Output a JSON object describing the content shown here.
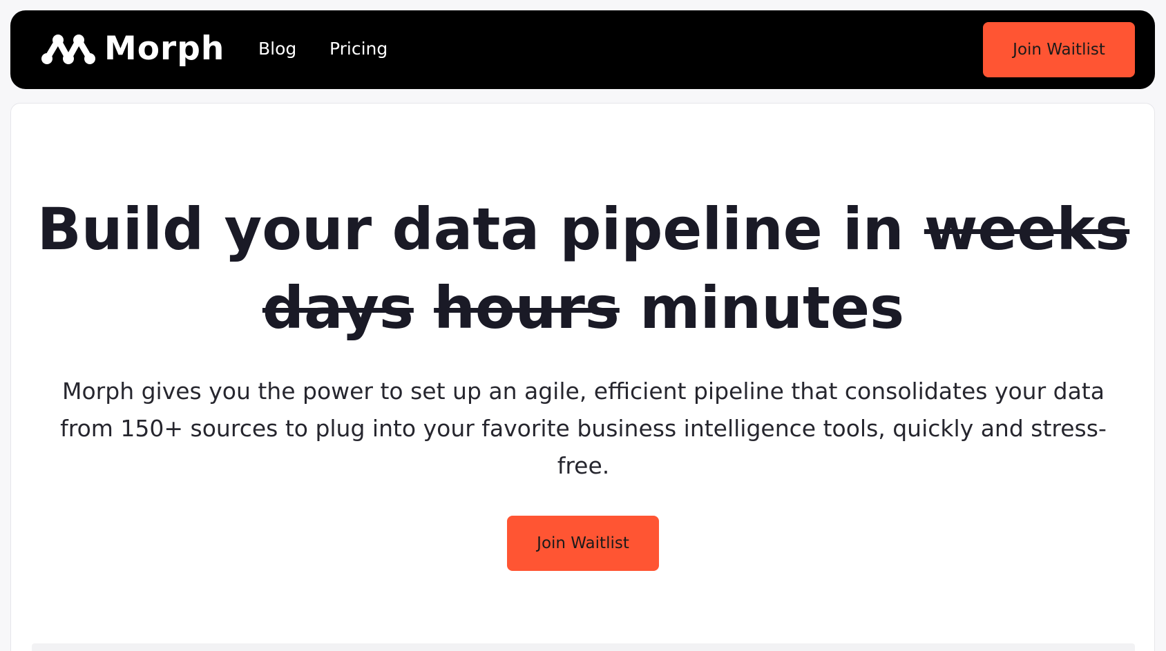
{
  "brand": {
    "name": "Morph",
    "logo_icon": "morph-molecule-logo",
    "accent_color": "#ff5533",
    "nav_background": "#000000"
  },
  "nav": {
    "links": [
      {
        "label": "Blog"
      },
      {
        "label": "Pricing"
      }
    ],
    "cta_label": "Join Waitlist"
  },
  "hero": {
    "headline_main": "Build your data pipeline in",
    "struck_words": [
      "weeks",
      "days",
      "hours"
    ],
    "headline_final": "minutes",
    "subtext": "Morph gives you the power to set up an agile, efficient pipeline that consolidates your data from 150+ sources to plug into your favorite business intelligence tools, quickly and stress-free.",
    "cta_label": "Join Waitlist"
  }
}
